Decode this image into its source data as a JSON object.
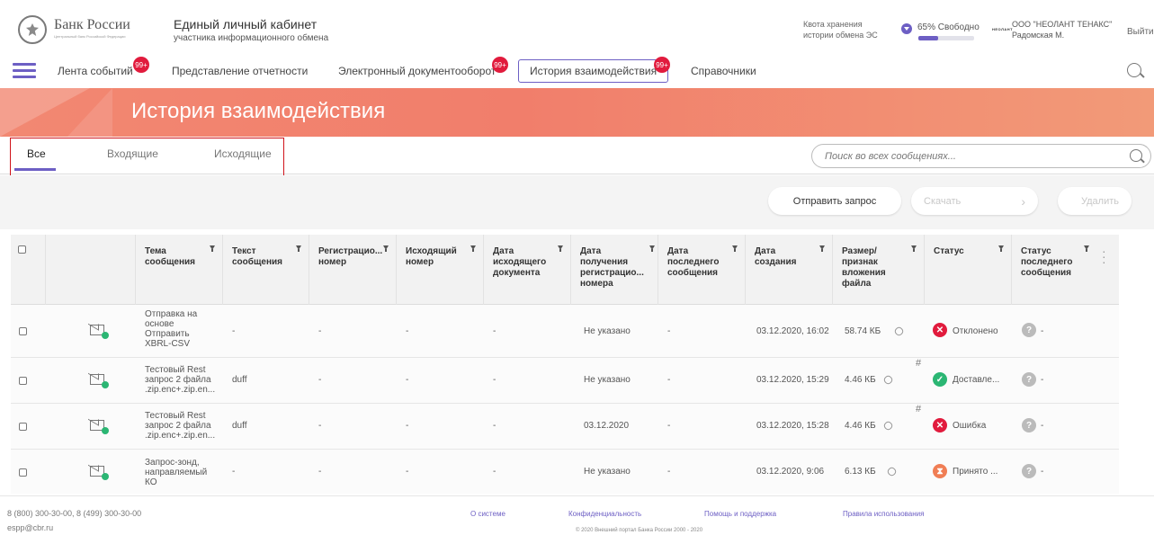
{
  "header": {
    "logo_title": "Банк России",
    "logo_subtitle": "Центральный банк Российской Федерации",
    "cabinet_title": "Единый личный кабинет",
    "cabinet_subtitle": "участника информационного обмена",
    "quota_line1": "Квота хранения",
    "quota_line2": "истории обмена ЭС",
    "quota_text": "65% Свободно",
    "quota_free_percent": 65,
    "quota_used_percent": 35,
    "org_logo": "НЕОЛАНТ",
    "org_name": "ООО \"НЕОЛАНТ ТЕНАКС\"",
    "user_name": "Радомская М.",
    "logout": "Выйти"
  },
  "nav": {
    "items": [
      {
        "label": "Лента событий",
        "badge": "99+"
      },
      {
        "label": "Представление отчетности",
        "badge": ""
      },
      {
        "label": "Электронный документооборот",
        "badge": "99+"
      },
      {
        "label": "История взаимодействия",
        "badge": "99+"
      },
      {
        "label": "Справочники",
        "badge": ""
      }
    ]
  },
  "page": {
    "title": "История взаимодействия"
  },
  "tabs": [
    "Все",
    "Входящие",
    "Исходящие"
  ],
  "search": {
    "placeholder": "Поиск во всех сообщениях..."
  },
  "toolbar": {
    "send_request": "Отправить запрос",
    "download": "Скачать",
    "next": "›",
    "delete": "Удалить"
  },
  "table": {
    "columns": [
      "Тема сообщения",
      "Текст сообщения",
      "Регистрацио... номер",
      "Исходящий номер",
      "Дата исходящего документа",
      "Дата получения регистрацио... номера",
      "Дата последнего сообщения",
      "Дата создания",
      "Размер/ признак вложения файла",
      "Статус",
      "Статус последнего сообщения"
    ],
    "rows": [
      {
        "topic": "Отправка на основе Отправить XBRL-CSV",
        "text": "-",
        "reg": "-",
        "out": "-",
        "out_date": "-",
        "reg_date": "Не указано",
        "last_date": "-",
        "created": "03.12.2020, 16:02",
        "size": "58.74 КБ",
        "hash": "",
        "status": "Отклонено",
        "status_icon": "cross",
        "status_color": "#e11b3d",
        "last_status": "-"
      },
      {
        "topic": "Тестовый Rest запрос 2 файла .zip.enc+.zip.en...",
        "text": "duff",
        "reg": "-",
        "out": "-",
        "out_date": "-",
        "reg_date": "Не указано",
        "last_date": "-",
        "created": "03.12.2020, 15:29",
        "size": "4.46 КБ",
        "hash": "#",
        "status": "Доставле...",
        "status_icon": "check",
        "status_color": "#2bb673",
        "last_status": "-"
      },
      {
        "topic": "Тестовый Rest запрос 2 файла .zip.enc+.zip.en...",
        "text": "duff",
        "reg": "-",
        "out": "-",
        "out_date": "-",
        "reg_date": "03.12.2020",
        "last_date": "-",
        "created": "03.12.2020, 15:28",
        "size": "4.46 КБ",
        "hash": "#",
        "status": "Ошибка",
        "status_icon": "cross",
        "status_color": "#e11b3d",
        "last_status": "-"
      },
      {
        "topic": "Запрос-зонд, направляемый КО",
        "text": "-",
        "reg": "-",
        "out": "-",
        "out_date": "-",
        "reg_date": "Не указано",
        "last_date": "-",
        "created": "03.12.2020, 9:06",
        "size": "6.13 КБ",
        "hash": "",
        "status": "Принято ...",
        "status_icon": "hourglass",
        "status_color": "#f07e55",
        "last_status": "-"
      }
    ]
  },
  "footer": {
    "phone": "8 (800) 300-30-00, 8 (499) 300-30-00",
    "email": "espp@cbr.ru",
    "links": [
      "О системе",
      "Конфиденциальность",
      "Помощь и поддержка",
      "Правила использования"
    ],
    "copyright": "© 2020 Внешний портал Банка России 2000 - 2020"
  }
}
